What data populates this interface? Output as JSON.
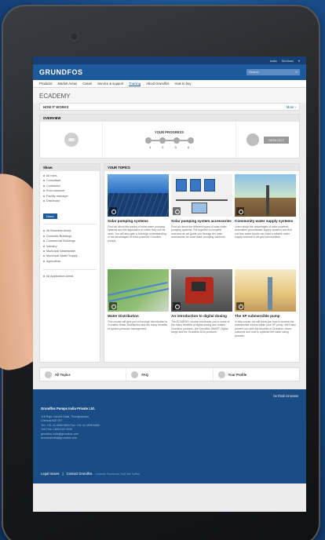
{
  "header": {
    "top_links": [
      "India",
      "Services",
      "▾"
    ],
    "logo": "GRUNDFOS",
    "search_placeholder": "Search"
  },
  "nav": {
    "items": [
      "Products",
      "Market Areas",
      "Cases",
      "Service & support",
      "Training",
      "About Grundfos",
      "How to buy"
    ],
    "active_index": 4
  },
  "page": {
    "title": "ECADEMY",
    "how_it_works": "HOW IT WORKS",
    "how_it_works_more": "More ›"
  },
  "overview": {
    "title": "OVERVIEW",
    "progress_title": "YOUR PROGRESS",
    "steps": [
      "1",
      "2",
      "3",
      "4"
    ],
    "signout": "SIGN OUT"
  },
  "show": {
    "title": "Show:",
    "roles": [
      "All roles",
      "Consultant",
      "Contractor",
      "End-customer",
      "Facility manager",
      "Distributor"
    ],
    "done": "Done",
    "business_areas": [
      "All Business Areas",
      "Domestic Buildings",
      "Commercial Buildings",
      "Industry",
      "Municipal Wastewater",
      "Municipal Water Supply",
      "Agriculture"
    ],
    "application_areas": [
      "All Application Areas"
    ]
  },
  "topics": {
    "title": "YOUR TOPICS",
    "cards": [
      {
        "title": "Solar pumping systems",
        "text": "Find out about the basics of solar water pumping systems and the application in which they can be used. You will also gain a thorough understanding of the advantages of solar-powered Grundfos pumps."
      },
      {
        "title": "Solar pumping system accessories",
        "text": "Find out about the different types of solar water pumping systems. Put together a complete overview as we guide you through the main accessories for solar water pumping solutions."
      },
      {
        "title": "Community water supply systems",
        "text": "Learn about the advantages of solar powered, automated groundwater supply systems and find out how water kiosks can build a reliable water supply scheme in off-grid communities."
      },
      {
        "title": "Water Distribution",
        "text": "This course will give you a thorough introduction to Grundfos Water Distribution and the many benefits of system pressure management."
      },
      {
        "title": "An introduction to digital dosing",
        "text": "The ECADEMY course introduces you to some of the many benefits of digital dosing and related Grundfos products; the Grundfos SMART Digital range and the Grundfos DDA products."
      },
      {
        "title": "The SP submersible pump",
        "text": "In this course, we will show you how to access the submersible motors within your SP pump. We'll also present you with the benefits of Grundfos' clever solutions and how to optimise the cable sizing process."
      }
    ]
  },
  "bottom_links": [
    "All Topics",
    "FAQ",
    "Your Profile"
  ],
  "footer": {
    "tagline": "be think innovate",
    "company": "Grundfos Pumps India Private Ltd.",
    "address": "118 Rajiv Gandhi Salai, Thoraipakkam,\nChennai 600 097\nTel.: +91 44 4596 6800 Fax: +91 44 4596 6969\nToll Free: 1800 102 2535\ngrundfos.india@grundfos.com\nservicesindia@grundfos.com",
    "legal": "Legal Issues",
    "contact": "Contact Grundfos",
    "social": "LinkedIn  Facebook  YouTube  Twitter"
  }
}
